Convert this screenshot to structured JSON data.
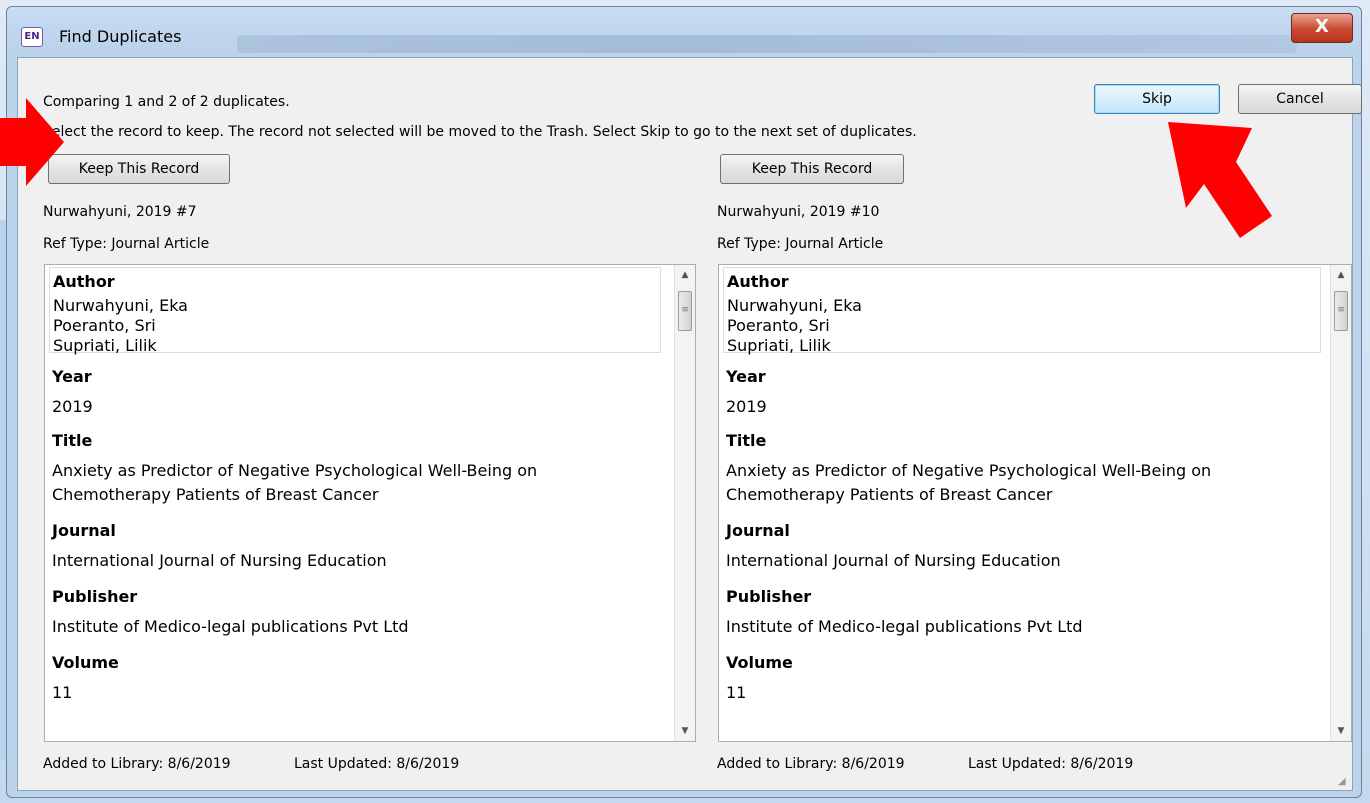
{
  "window": {
    "app_icon": "EN",
    "title": "Find Duplicates",
    "close_label": "X"
  },
  "header": {
    "comparing_text": "Comparing 1 and 2 of 2 duplicates.",
    "instruction_text": "Select the record to keep. The record not selected will be moved to the Trash. Select Skip to go to the next set of duplicates."
  },
  "toolbar": {
    "skip_label": "Skip",
    "cancel_label": "Cancel"
  },
  "records": [
    {
      "keep_label": "Keep This Record",
      "ref_id": "Nurwahyuni, 2019 #7",
      "ref_type": "Ref Type: Journal Article",
      "author_heading": "Author",
      "authors": [
        "Nurwahyuni, Eka",
        "Poeranto, Sri",
        "Supriati, Lilik"
      ],
      "year_heading": "Year",
      "year": "2019",
      "title_heading": "Title",
      "title_lines": [
        "Anxiety as Predictor of Negative Psychological Well-Being on",
        "Chemotherapy Patients of Breast Cancer"
      ],
      "journal_heading": "Journal",
      "journal": "International Journal of Nursing Education",
      "publisher_heading": "Publisher",
      "publisher": "Institute of Medico-legal publications Pvt Ltd",
      "volume_heading": "Volume",
      "volume": "11",
      "added": "Added to Library: 8/6/2019",
      "updated": "Last Updated: 8/6/2019"
    },
    {
      "keep_label": "Keep This Record",
      "ref_id": "Nurwahyuni, 2019 #10",
      "ref_type": "Ref Type: Journal Article",
      "author_heading": "Author",
      "authors": [
        "Nurwahyuni, Eka",
        "Poeranto, Sri",
        "Supriati, Lilik"
      ],
      "year_heading": "Year",
      "year": "2019",
      "title_heading": "Title",
      "title_lines": [
        "Anxiety as Predictor of Negative Psychological Well-Being on",
        "Chemotherapy Patients of Breast Cancer"
      ],
      "journal_heading": "Journal",
      "journal": "International Journal of Nursing Education",
      "publisher_heading": "Publisher",
      "publisher": "Institute of Medico-legal publications Pvt Ltd",
      "volume_heading": "Volume",
      "volume": "11",
      "added": "Added to Library: 8/6/2019",
      "updated": "Last Updated: 8/6/2019"
    }
  ],
  "icons": {
    "scroll_up": "scroll-up-arrow-icon",
    "scroll_down": "scroll-down-arrow-icon",
    "annotation_arrows": "red-arrow-icon"
  },
  "colors": {
    "annotation_red": "#ff0000",
    "close_button": "#c94a32",
    "default_button_border": "#3c7fb1"
  }
}
